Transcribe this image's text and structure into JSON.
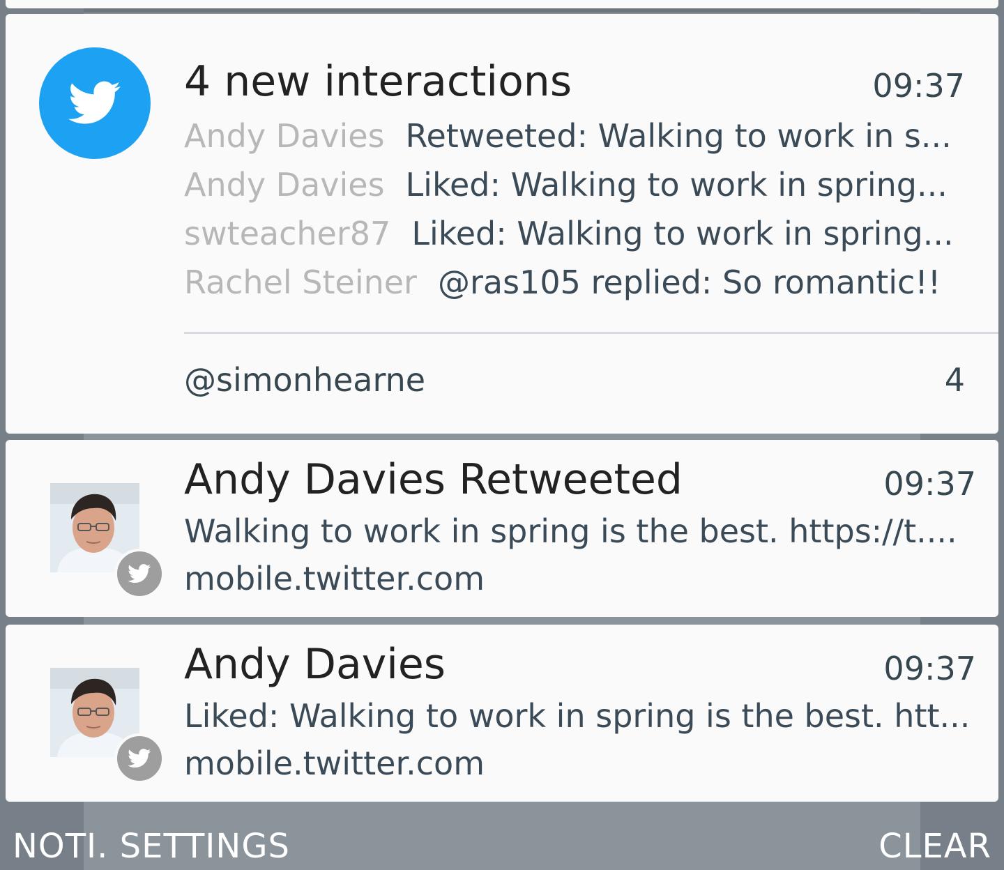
{
  "twitter_group": {
    "title": "4 new interactions",
    "time": "09:37",
    "rows": [
      {
        "name": "Andy Davies",
        "text": "Retweeted: Walking to work in s..."
      },
      {
        "name": "Andy Davies",
        "text": "Liked: Walking to work in spring..."
      },
      {
        "name": "swteacher87",
        "text": "Liked: Walking to work in spring..."
      },
      {
        "name": "Rachel Steiner",
        "text": "@ras105 replied: So romantic!!"
      }
    ],
    "account": "@simonhearne",
    "count": "4"
  },
  "notifications": [
    {
      "title": "Andy Davies Retweeted",
      "time": "09:37",
      "body": "Walking to work in spring is the best. https://t....",
      "source": "mobile.twitter.com"
    },
    {
      "title": "Andy Davies",
      "time": "09:37",
      "body": "Liked: Walking to work in spring is the best. htt...",
      "source": "mobile.twitter.com"
    }
  ],
  "footer": {
    "settings_label": "NOTI. SETTINGS",
    "clear_label": "CLEAR"
  },
  "colors": {
    "twitter_blue": "#1da1f2",
    "shade_background": "#778089",
    "card_background": "#fafafa",
    "badge_gray": "#9e9e9e"
  },
  "icons": {
    "app_icon": "twitter-bird-icon",
    "small_badge": "twitter-bird-icon"
  }
}
